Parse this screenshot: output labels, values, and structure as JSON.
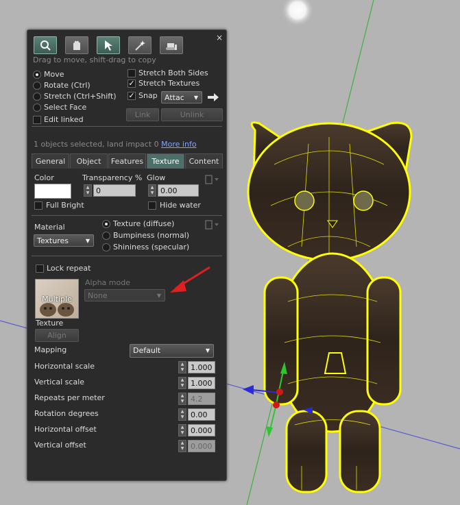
{
  "toolbar": {
    "buttons": [
      {
        "name": "focus-tool",
        "icon": "magnifier-icon"
      },
      {
        "name": "move-tool",
        "icon": "hand-icon"
      },
      {
        "name": "edit-tool",
        "icon": "cursor-icon"
      },
      {
        "name": "create-tool",
        "icon": "wand-icon"
      },
      {
        "name": "land-tool",
        "icon": "bulldozer-icon"
      }
    ],
    "close": "×"
  },
  "hint": "Drag to move, shift-drag to copy",
  "edit_modes": [
    "Move",
    "Rotate (Ctrl)",
    "Stretch (Ctrl+Shift)",
    "Select Face"
  ],
  "edit_linked": "Edit linked",
  "stretch_both": "Stretch Both Sides",
  "stretch_textures": "Stretch Textures",
  "snap": "Snap",
  "snap_mode": "Attac",
  "link_btn": "Link",
  "unlink_btn": "Unlink",
  "selection_info": "1 objects selected, land impact 0",
  "more_info": "More info",
  "tabs": [
    "General",
    "Object",
    "Features",
    "Texture",
    "Content"
  ],
  "selected_tab": "Texture",
  "color_label": "Color",
  "transparency_label": "Transparency %",
  "transparency_value": "0",
  "glow_label": "Glow",
  "glow_value": "0.00",
  "full_bright": "Full Bright",
  "hide_water": "Hide water",
  "material_label": "Material",
  "material_value": "Textures",
  "texture_modes": [
    "Texture (diffuse)",
    "Bumpiness (normal)",
    "Shininess (specular)"
  ],
  "lock_repeat": "Lock repeat",
  "texture_thumb_text": "Multiple",
  "alpha_mode_label": "Alpha mode",
  "alpha_mode_value": "None",
  "texture_label": "Texture",
  "align_btn": "Align",
  "mapping_label": "Mapping",
  "mapping_value": "Default",
  "params": [
    {
      "label": "Horizontal scale",
      "value": "1.000",
      "enabled": true
    },
    {
      "label": "Vertical scale",
      "value": "1.000",
      "enabled": true
    },
    {
      "label": "Repeats per meter",
      "value": "4.2",
      "enabled": false
    },
    {
      "label": "Rotation degrees",
      "value": "0.00",
      "enabled": true
    },
    {
      "label": "Horizontal offset",
      "value": "0.000",
      "enabled": true
    },
    {
      "label": "Vertical offset",
      "value": "0.000",
      "enabled": false
    }
  ],
  "colors": {
    "panel": "#2b2b2b",
    "selected_tab": "#4d6f6a",
    "highlight": "#ffff00",
    "arrow": "#e02020",
    "viewport": "#b4b4b4"
  }
}
